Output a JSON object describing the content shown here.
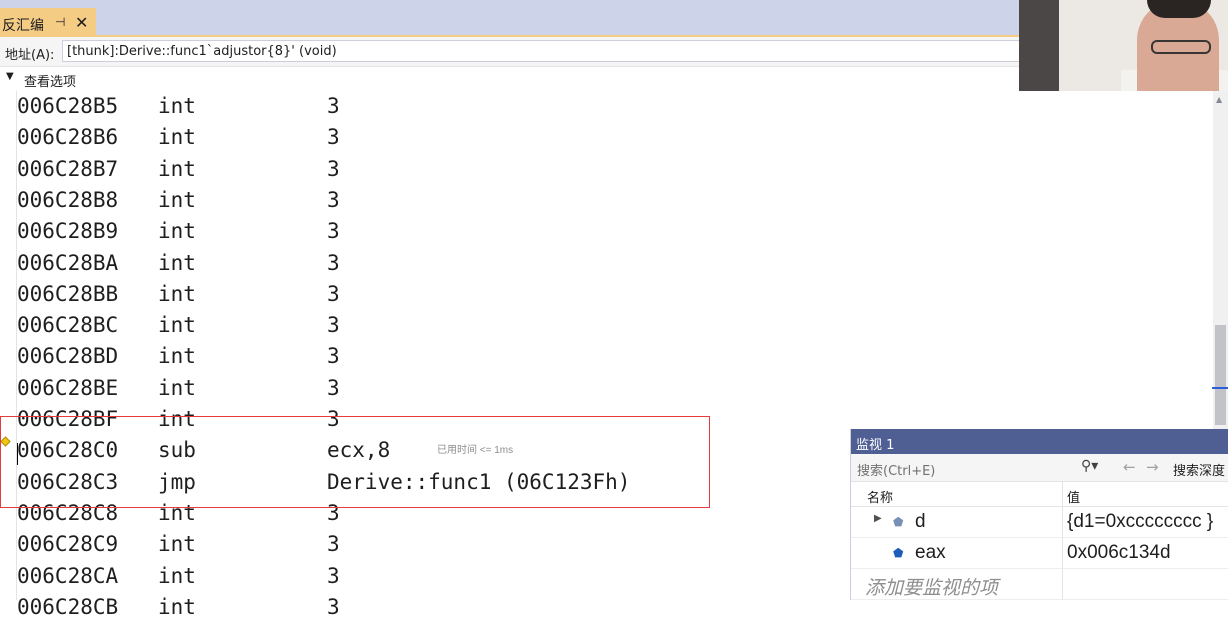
{
  "tab": {
    "title": "反汇编",
    "pin_icon": "pin-icon",
    "close_glyph": "✕"
  },
  "address_bar": {
    "label": "地址(A):",
    "value": "[thunk]:Derive::func1`adjustor{8}' (void)"
  },
  "view_options": {
    "label": "查看选项"
  },
  "disassembly": [
    {
      "address": "006C28B5",
      "op": "int",
      "arg": "3"
    },
    {
      "address": "006C28B6",
      "op": "int",
      "arg": "3"
    },
    {
      "address": "006C28B7",
      "op": "int",
      "arg": "3"
    },
    {
      "address": "006C28B8",
      "op": "int",
      "arg": "3"
    },
    {
      "address": "006C28B9",
      "op": "int",
      "arg": "3"
    },
    {
      "address": "006C28BA",
      "op": "int",
      "arg": "3"
    },
    {
      "address": "006C28BB",
      "op": "int",
      "arg": "3"
    },
    {
      "address": "006C28BC",
      "op": "int",
      "arg": "3"
    },
    {
      "address": "006C28BD",
      "op": "int",
      "arg": "3"
    },
    {
      "address": "006C28BE",
      "op": "int",
      "arg": "3"
    },
    {
      "address": "006C28BF",
      "op": "int",
      "arg": "3"
    },
    {
      "address": "006C28C0",
      "op": "sub",
      "arg": "ecx,8",
      "hint": "已用时间 <= 1ms"
    },
    {
      "address": "006C28C3",
      "op": "jmp",
      "arg": "Derive::func1 (06C123Fh)"
    },
    {
      "address": "006C28C8",
      "op": "int",
      "arg": "3"
    },
    {
      "address": "006C28C9",
      "op": "int",
      "arg": "3"
    },
    {
      "address": "006C28CA",
      "op": "int",
      "arg": "3"
    },
    {
      "address": "006C28CB",
      "op": "int",
      "arg": "3"
    }
  ],
  "watch": {
    "title": "监视 1",
    "search_placeholder": "搜索(Ctrl+E)",
    "search_depth_label": "搜索深度",
    "col_name": "名称",
    "col_value": "值",
    "rows": [
      {
        "name": "d",
        "value": "{d1=0xcccccccc }",
        "expandable": true
      },
      {
        "name": "eax",
        "value": "0x006c134d",
        "expandable": false
      }
    ],
    "add_placeholder": "添加要监视的项"
  },
  "colors": {
    "tab_active": "#f5cc84",
    "watch_title_bg": "#4f5f94",
    "highlight_box": "#e43c3c"
  }
}
